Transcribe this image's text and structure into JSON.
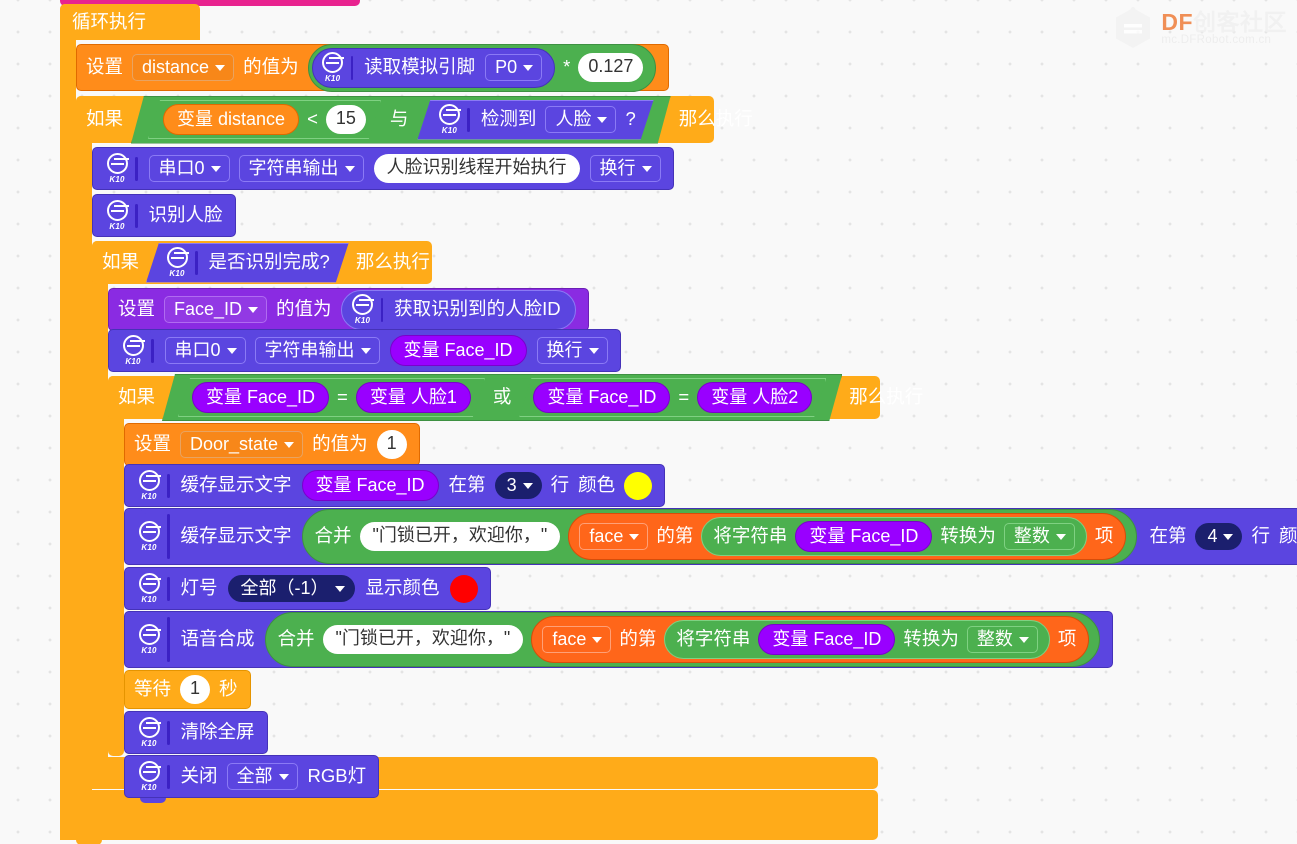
{
  "app": {
    "canvas_background": "#f9f9f9",
    "watermark": {
      "brand_prefix": "DF",
      "brand_suffix": "创客社区",
      "url": "mc.DFRobot.com.cn",
      "logo_icon": "df-hexagon-logo-icon"
    }
  },
  "palette": {
    "loop_orange": "#ffab19",
    "loop_orange_dark": "#f59e0b",
    "variable_orange": "#ff8c1a",
    "variable_orange_dark": "#e06a00",
    "extension_purple": "#5b45e0",
    "extension_purple_light": "#6b4ff0",
    "operator_green": "#4cb04f",
    "operator_green_dark": "#3e9142",
    "variable_pill_purple": "#9900ff",
    "event_magenta": "#e8238f",
    "list_orange": "#ff661a",
    "navy_field": "#1b1f6e",
    "color_yellow": "#ffff00",
    "color_red": "#ff0000"
  },
  "blocks": {
    "event_hat": {
      "name": "event-hat-block",
      "label": ""
    },
    "forever": {
      "label": "循环执行"
    },
    "set_distance": {
      "set_label": "设置",
      "variable": "distance",
      "to_label": "的值为",
      "read_pin_label": "读取模拟引脚",
      "pin": "P0",
      "multiply_op": "*",
      "multiplier": "0.127"
    },
    "if_distance": {
      "if_label": "如果",
      "var_label": "变量 distance",
      "compare_op": "<",
      "compare_value": "15",
      "and_label": "与",
      "detect_label": "检测到",
      "detect_target": "人脸",
      "question_mark": "?",
      "then_label": "那么执行"
    },
    "serial_print_1": {
      "port": "串口0",
      "mode": "字符串输出",
      "text": "人脸识别线程开始执行",
      "newline": "换行"
    },
    "recognize_face": {
      "label": "识别人脸"
    },
    "if_recognized": {
      "if_label": "如果",
      "condition": "是否识别完成?",
      "then_label": "那么执行"
    },
    "set_face_id": {
      "set_label": "设置",
      "variable": "Face_ID",
      "to_label": "的值为",
      "getter_label": "获取识别到的人脸ID"
    },
    "serial_print_2": {
      "port": "串口0",
      "mode": "字符串输出",
      "variable": "变量 Face_ID",
      "newline": "换行"
    },
    "if_face_match": {
      "if_label": "如果",
      "left_var_a": "变量 Face_ID",
      "eq_a": "=",
      "right_var_a": "变量 人脸1",
      "or_label": "或",
      "left_var_b": "变量 Face_ID",
      "eq_b": "=",
      "right_var_b": "变量 人脸2",
      "then_label": "那么执行"
    },
    "set_door_state": {
      "set_label": "设置",
      "variable": "Door_state",
      "to_label": "的值为",
      "value": "1"
    },
    "cache_text_1": {
      "label": "缓存显示文字",
      "variable": "变量 Face_ID",
      "at_line_label": "在第",
      "line": "3",
      "line_unit": "行",
      "color_label": "颜色",
      "color": "#ffff00"
    },
    "cache_text_2": {
      "label": "缓存显示文字",
      "join_label": "合并",
      "string": "\"门锁已开，欢迎你，\"",
      "list_name": "face",
      "index_label": "的第",
      "to_number_label": "将字符串",
      "variable": "变量 Face_ID",
      "convert_label": "转换为",
      "convert_type": "整数",
      "item_label": "项",
      "at_line_label": "在第",
      "line": "4",
      "line_unit": "行",
      "color_label": "颜色",
      "color": "#ff0000"
    },
    "rgb_show": {
      "label": "灯号",
      "lamp": "全部（-1）",
      "show_label": "显示颜色",
      "color": "#ff0000"
    },
    "speech_synth": {
      "label": "语音合成",
      "join_label": "合并",
      "string": "\"门锁已开，欢迎你，\"",
      "list_name": "face",
      "index_label": "的第",
      "to_number_label": "将字符串",
      "variable": "变量 Face_ID",
      "convert_label": "转换为",
      "convert_type": "整数",
      "item_label": "项"
    },
    "wait": {
      "label": "等待",
      "seconds": "1",
      "unit": "秒"
    },
    "clear_screen": {
      "label": "清除全屏"
    },
    "turn_off_rgb": {
      "label": "关闭",
      "lamp": "全部",
      "suffix": "RGB灯"
    }
  }
}
